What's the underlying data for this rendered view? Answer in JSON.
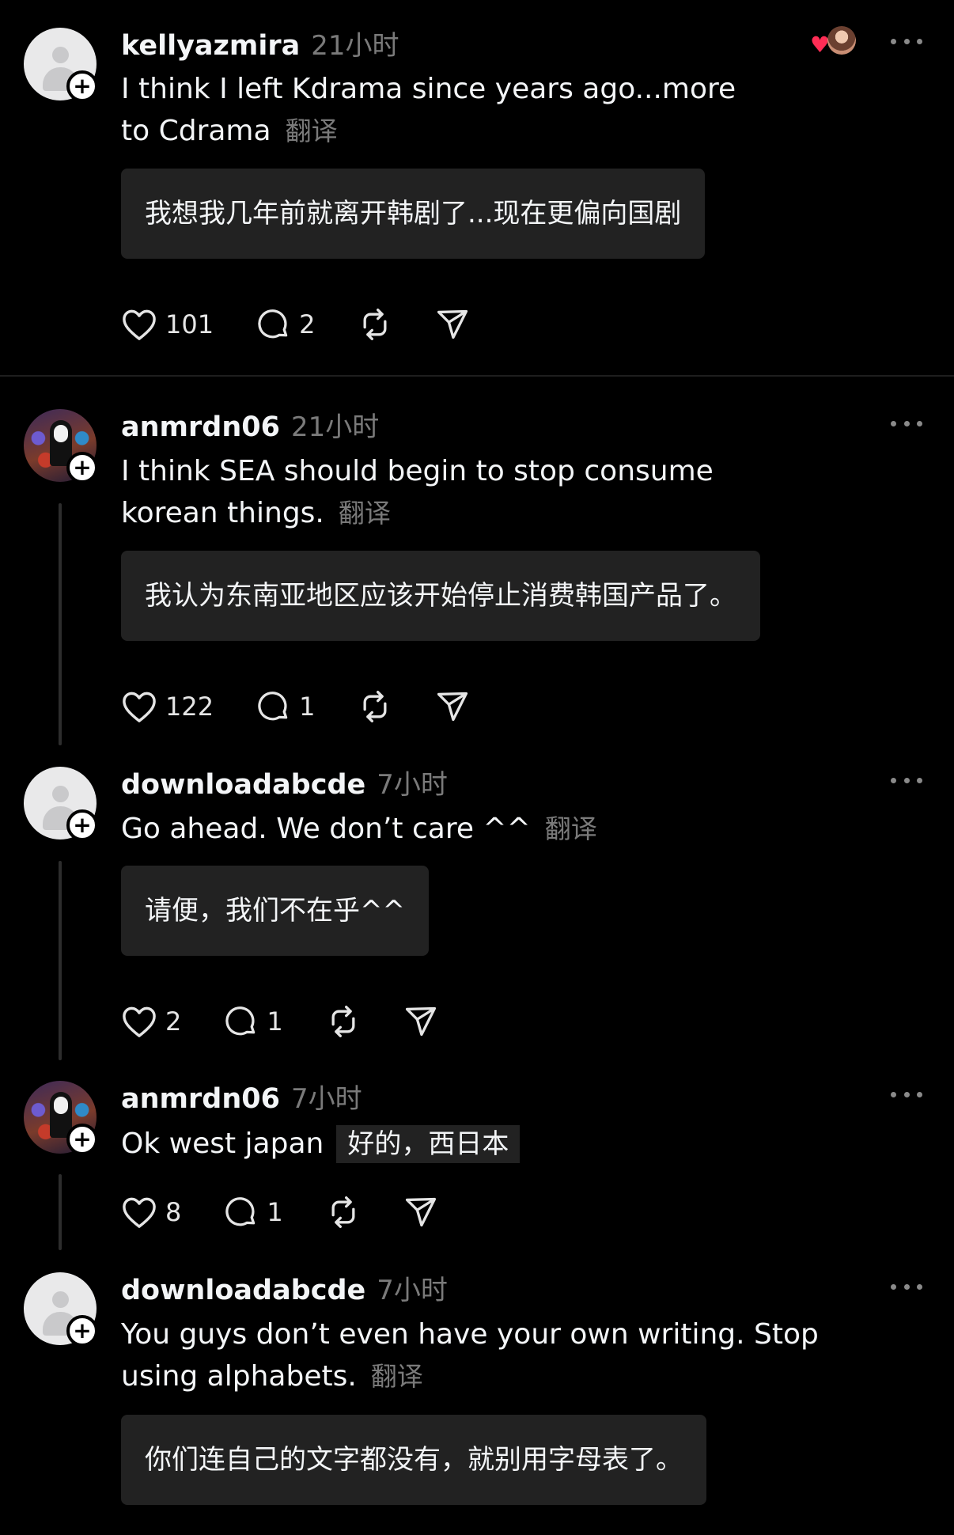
{
  "posts": [
    {
      "username": "kellyazmira",
      "time": "21小时",
      "text_line1": "I think I left Kdrama since years ago...more",
      "text_line2": "to Cdrama",
      "translate_label": "翻译",
      "translation": "我想我几年前就离开韩剧了...现在更偏向国剧",
      "likes": "101",
      "replies": "2"
    },
    {
      "username": "anmrdn06",
      "time": "21小时",
      "text_line1": "I think SEA should begin to stop consume",
      "text_line2": "korean things.",
      "translate_label": "翻译",
      "translation": "我认为东南亚地区应该开始停止消费韩国产品了。",
      "likes": "122",
      "replies": "1"
    },
    {
      "username": "downloadabcde",
      "time": "7小时",
      "text_line1": "Go ahead. We don’t care ^^",
      "translate_label": "翻译",
      "translation": "请便，我们不在乎^^",
      "likes": "2",
      "replies": "1"
    },
    {
      "username": "anmrdn06",
      "time": "7小时",
      "text_line1": "Ok west japan",
      "translation": "好的，西日本",
      "likes": "8",
      "replies": "1"
    },
    {
      "username": "downloadabcde",
      "time": "7小时",
      "text_line1": "You guys don’t even have your own writing. Stop",
      "text_line2": "using alphabets.",
      "translate_label": "翻译",
      "translation": "你们连自己的文字都没有，就别用字母表了。"
    }
  ],
  "icons": {
    "like": "heart-icon",
    "reply": "comment-icon",
    "repost": "repost-icon",
    "share": "send-icon",
    "more": "more-icon",
    "follow": "plus-icon"
  },
  "colors": {
    "background": "#000000",
    "text": "#f3f5f7",
    "muted": "#7a7a7a",
    "translation_bg": "#222222",
    "like_heart": "#ff2d55"
  }
}
